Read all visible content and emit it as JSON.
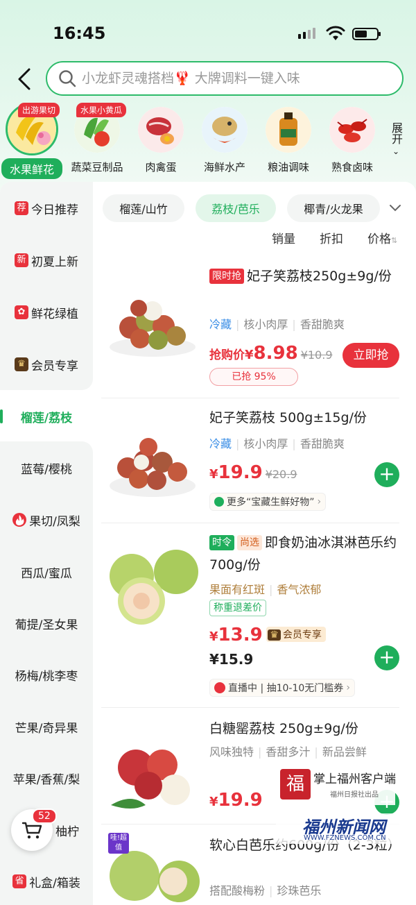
{
  "status_bar": {
    "time": "16:45"
  },
  "search": {
    "placeholder": "小龙虾灵魂搭档🦞 大牌调料一键入味"
  },
  "categories": [
    {
      "label": "水果鲜花",
      "tag": "出游果切",
      "active": true
    },
    {
      "label": "蔬菜豆制品",
      "tag": "水果小黄瓜"
    },
    {
      "label": "肉禽蛋"
    },
    {
      "label": "海鲜水产"
    },
    {
      "label": "粮油调味"
    },
    {
      "label": "熟食卤味"
    }
  ],
  "expand_label": "展开",
  "sidebar": {
    "items": [
      {
        "label": "今日推荐",
        "icon_char": "荐"
      },
      {
        "label": "初夏上新",
        "icon_char": "新"
      },
      {
        "label": "鲜花绿植",
        "icon_char": "✿"
      },
      {
        "label": "会员专享",
        "icon_char": "♛"
      },
      {
        "label": "榴莲/荔枝"
      },
      {
        "label": "蓝莓/樱桃"
      },
      {
        "label": "果切/凤梨",
        "icon_char": "🔥"
      },
      {
        "label": "西瓜/蜜瓜"
      },
      {
        "label": "葡提/圣女果"
      },
      {
        "label": "杨梅/桃李枣"
      },
      {
        "label": "芒果/奇异果"
      },
      {
        "label": "苹果/香蕉/梨"
      },
      {
        "label": "柚柠"
      },
      {
        "label": "礼盒/箱装",
        "icon_char": "省"
      }
    ]
  },
  "subtabs": [
    "榴莲/山竹",
    "荔枝/芭乐",
    "椰青/火龙果"
  ],
  "sort": {
    "sales": "销量",
    "discount": "折扣",
    "price": "价格"
  },
  "products": [
    {
      "tags": [
        "限时抢"
      ],
      "title": "妃子笑荔枝250g±9g/份",
      "attrs": [
        "冷藏",
        "核小肉厚",
        "香甜脆爽"
      ],
      "price_prefix": "抢购价",
      "price": "8.98",
      "orig_price": "¥10.9",
      "button": "立即抢",
      "progress_text": "已抢 95%"
    },
    {
      "title": "妃子笑荔枝 500g±15g/份",
      "attrs": [
        "冷藏",
        "核小肉厚",
        "香甜脆爽"
      ],
      "price": "19.9",
      "orig_price": "¥20.9",
      "more": "更多“宝藏生鲜好物”"
    },
    {
      "tags": [
        "时令",
        "尚选"
      ],
      "title": "即食奶油冰淇淋芭乐约700g/份",
      "attrs": [
        "果面有红斑",
        "香气浓郁"
      ],
      "badge": "称重退差价",
      "price": "13.9",
      "member_label": "会员专享",
      "regular_price": "¥15.9",
      "live": "直播中 | 抽10-10无门槛券"
    },
    {
      "title": "白糖罂荔枝 250g±9g/份",
      "attrs": [
        "风味独特",
        "香甜多汁",
        "新品尝鲜"
      ],
      "price": "19.9"
    },
    {
      "corner_tag": "哇!超值",
      "title": "软心白芭乐约600g/份（2-3粒）",
      "attrs": [
        "搭配酸梅粉",
        "珍珠芭乐"
      ]
    }
  ],
  "cart": {
    "count": "52"
  },
  "watermark": {
    "line1": "掌上福州客户端",
    "line1_sub": "福州日报社出品",
    "line2": "福州新闻网",
    "line2_sub": "WWW.FZNEWS.COM.CN"
  },
  "colors": {
    "accent": "#1fae5b",
    "price": "#e8323c"
  }
}
